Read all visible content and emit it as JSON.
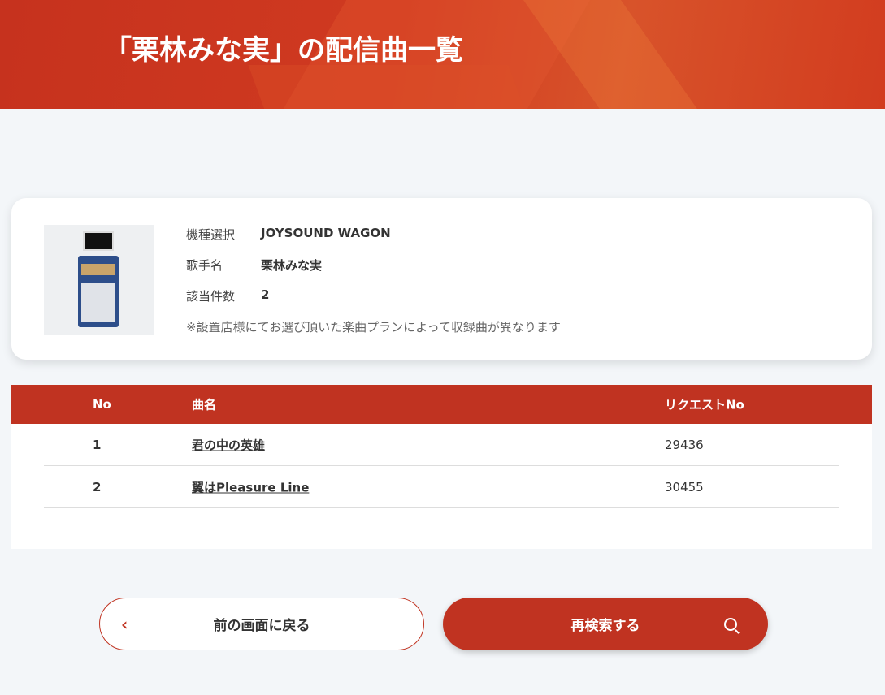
{
  "header": {
    "title": "「栗林みな実」の配信曲一覧"
  },
  "info": {
    "model_label": "機種選択",
    "model_value": "JOYSOUND WAGON",
    "artist_label": "歌手名",
    "artist_value": "栗林みな実",
    "count_label": "該当件数",
    "count_value": "2",
    "note": "※設置店様にてお選び頂いた楽曲プランによって収録曲が異なります"
  },
  "table": {
    "headers": [
      "No",
      "曲名",
      "リクエストNo"
    ],
    "rows": [
      {
        "no": "1",
        "title": "君の中の英雄",
        "request": "29436"
      },
      {
        "no": "2",
        "title": "翼はPleasure Line",
        "request": "30455"
      }
    ]
  },
  "buttons": {
    "back": "前の画面に戻る",
    "search": "再検索する"
  }
}
